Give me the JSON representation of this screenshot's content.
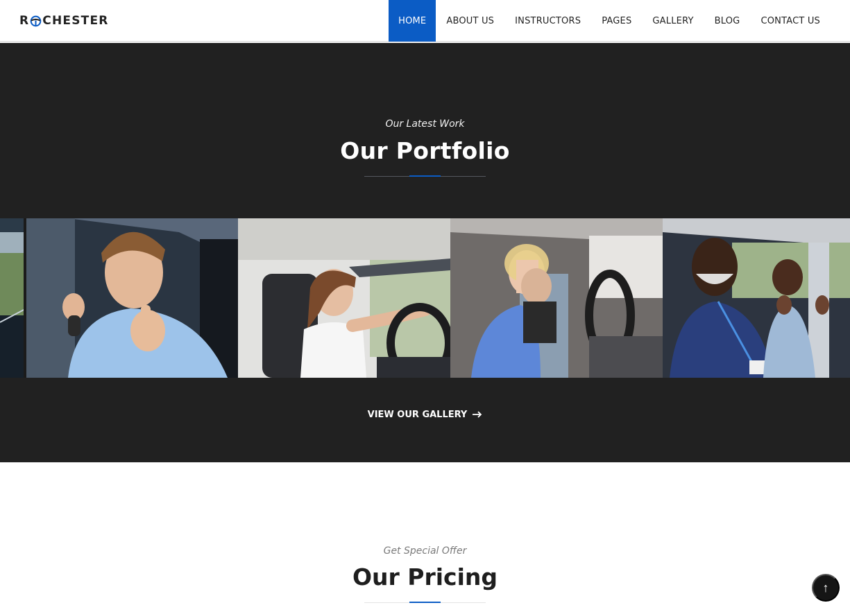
{
  "brand": {
    "logo_left": "R",
    "logo_right": "CHESTER",
    "mark_icon": "steering-wheel-icon",
    "accent_color": "#0b5cc5"
  },
  "nav": {
    "items": [
      {
        "label": "HOME",
        "active": true
      },
      {
        "label": "ABOUT US",
        "active": false
      },
      {
        "label": "INSTRUCTORS",
        "active": false
      },
      {
        "label": "PAGES",
        "active": false
      },
      {
        "label": "GALLERY",
        "active": false
      },
      {
        "label": "BLOG",
        "active": false
      },
      {
        "label": "CONTACT US",
        "active": false
      }
    ]
  },
  "portfolio": {
    "kicker": "Our Latest Work",
    "title": "Our Portfolio",
    "background": "#212121",
    "photos": [
      "partial-car-door-photo",
      "man-holding-car-keys-thumbs-up-photo",
      "woman-driving-car-photo",
      "woman-driver-with-instructor-photo",
      "couple-in-car-thumbs-up-photo"
    ],
    "cta_label": "VIEW OUR GALLERY",
    "cta_icon": "arrow-right-icon"
  },
  "pricing": {
    "kicker": "Get Special Offer",
    "title": "Our Pricing"
  },
  "scroll_top": {
    "icon": "arrow-up-icon",
    "glyph": "↑"
  }
}
